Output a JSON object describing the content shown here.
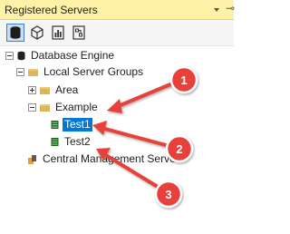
{
  "panel": {
    "title": "Registered Servers",
    "pin_glyph": "⊸"
  },
  "toolbar": {
    "buttons": [
      {
        "name": "database-engine-icon",
        "selected": true
      },
      {
        "name": "analysis-services-icon",
        "selected": false
      },
      {
        "name": "reporting-services-icon",
        "selected": false
      },
      {
        "name": "integration-services-icon",
        "selected": false
      }
    ]
  },
  "tree": {
    "database_engine": "Database Engine",
    "local_server_groups": "Local Server Groups",
    "area": "Area",
    "example": "Example",
    "test1": "Test1",
    "test2": "Test2",
    "central_management": "Central Management Server"
  },
  "callouts": [
    {
      "number": "1"
    },
    {
      "number": "2"
    },
    {
      "number": "3"
    }
  ],
  "colors": {
    "title_bg": "#fdf2a6",
    "selection": "#0078d7",
    "callout_red": "#e8413a"
  }
}
